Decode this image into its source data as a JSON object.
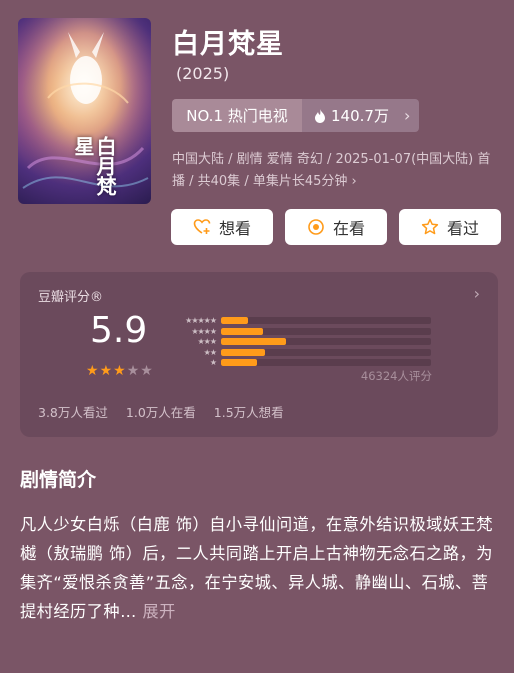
{
  "show": {
    "title": "白月梵星",
    "year": "(2025)",
    "poster_text": "白月梵星"
  },
  "rank": {
    "label": "NO.1 热门电视",
    "hot_value": "140.7万"
  },
  "meta_text": "中国大陆 / 剧情 爱情 奇幻 / 2025-01-07(中国大陆) 首播 / 共40集 / 单集片长45分钟",
  "actions": {
    "want": "想看",
    "watching": "在看",
    "watched": "看过"
  },
  "rating": {
    "label": "豆瓣评分®",
    "score": "5.9",
    "stars_filled": 3,
    "stars_total": 5,
    "distribution": [
      {
        "stars": 5,
        "fraction": 0.13
      },
      {
        "stars": 4,
        "fraction": 0.2
      },
      {
        "stars": 3,
        "fraction": 0.31
      },
      {
        "stars": 2,
        "fraction": 0.21
      },
      {
        "stars": 1,
        "fraction": 0.17
      }
    ],
    "count": "46324人评分",
    "watched": "3.8万人看过",
    "watching": "1.0万人在看",
    "want": "1.5万人想看"
  },
  "synopsis": {
    "title": "剧情简介",
    "text": "凡人少女白烁（白鹿 饰）自小寻仙问道，在意外结识极域妖王梵樾（敖瑞鹏 饰）后，二人共同踏上开启上古神物无念石之路，为集齐“爱恨杀贪善”五念，在宁安城、异人城、静幽山、石城、菩提村经历了种…",
    "expand_label": "展开"
  },
  "colors": {
    "background": "#7a5566",
    "card": "#6b4a5c",
    "bar": "#ff9b1a",
    "accent_star": "#ff9b1a"
  }
}
